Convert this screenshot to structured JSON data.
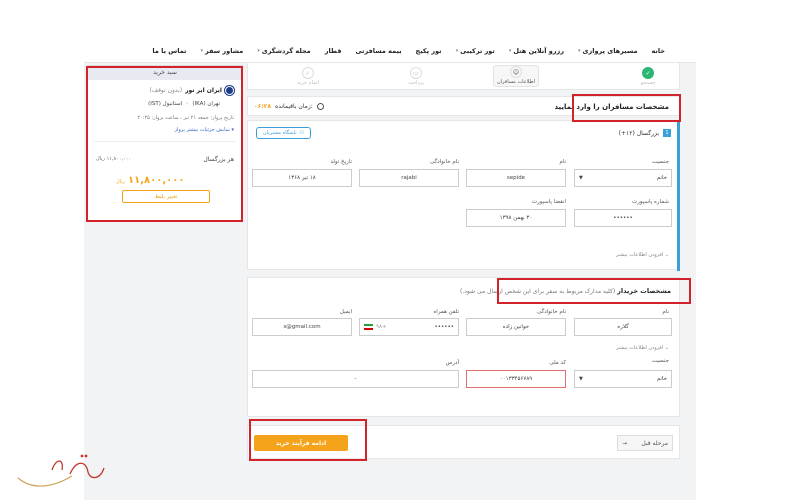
{
  "nav": {
    "items": [
      {
        "label": "خانه",
        "caret": false
      },
      {
        "label": "مسیرهای پروازی",
        "caret": true
      },
      {
        "label": "رزرو آنلاین هتل",
        "caret": true
      },
      {
        "label": "تور ترکیبی",
        "caret": true
      },
      {
        "label": "تور پکیج",
        "caret": false
      },
      {
        "label": "بیمه مسافرتی",
        "caret": false
      },
      {
        "label": "قطار",
        "caret": false
      },
      {
        "label": "مجله گردشگری",
        "caret": true
      },
      {
        "label": "مشاور سفر",
        "caret": true
      },
      {
        "label": "تماس با ما",
        "caret": false
      }
    ]
  },
  "stepper": {
    "steps": [
      "جستجو",
      "اطلاعات مسافران",
      "پرداخت",
      "اتمام خرید"
    ]
  },
  "timer": {
    "label": "زمان باقیمانده:",
    "value": "۰۶:۲۸"
  },
  "passengers": {
    "section_title": "مشخصات مسافران را وارد نمایید",
    "pax_number": "1",
    "pax_type": "بزرگسال (۱۲+)",
    "club_button": "باشگاه مشتریان",
    "fields": {
      "gender_label": "جنسیت",
      "gender_value": "خانم",
      "first_name_label": "نام",
      "first_name_value": "sepide",
      "last_name_label": "نام خانوادگی",
      "last_name_value": "rajabi",
      "birth_label": "تاریخ تولد",
      "birth_value": "۱۸ تیر ۱۳۶۸",
      "passport_no_label": "شماره پاسپورت",
      "passport_no_value": "••••••",
      "passport_exp_label": "انقضا پاسپورت",
      "passport_exp_value": "۳۰ بهمن ۱۳۹۸"
    },
    "more_info": "افزودن اطلاعات بیشتر"
  },
  "buyer": {
    "title": "مشخصات خریدار",
    "subtitle": "(کلیه مدارک مربوط به سفر برای این شخص ارسال می شود.)",
    "fields": {
      "name_label": "نام",
      "name_value": "گلاره",
      "last_name_label": "نام خانوادگی",
      "last_name_value": "خوانین زاده",
      "phone_label": "تلفن همراه",
      "phone_prefix": "+۹۸",
      "phone_value": "••••••",
      "email_label": "ایمیل",
      "email_value": "s@gmail.com",
      "gender_label": "جنسیت",
      "gender_value": "خانم",
      "national_code_label": "کد ملی",
      "national_code_value": "۰۰۱۳۳۴۵۶۷۸۹",
      "address_label": "آدرس",
      "address_value": "-"
    },
    "more_info": "افزودن اطلاعات بیشتر"
  },
  "actions": {
    "continue": "ادامه فرآیند خرید",
    "previous": "مرحله قبل"
  },
  "summary": {
    "header": "سبد خرید",
    "airline": "ایران ایر تور",
    "airline_note": "(بدون توقف)",
    "origin": "تهران (IKA)",
    "destination": "استانبول (IST)",
    "flight_date": "تاریخ پرواز: جمعه ۲۱ تیر ، ساعت پرواز: ۲۰:۴۵",
    "details_link": "نمایش جزئیات بیشتر پرواز",
    "per_adult_label": "هر بزرگسال",
    "per_adult_price": "۱۱,۸۰۰,۰۰۰ ریال",
    "total_price": "۱۱,۸۰۰,۰۰۰",
    "currency": "ریال",
    "change_button": "تغییر بلیط"
  },
  "colors": {
    "accent": "#f5a31a",
    "highlight": "#d2232a",
    "info_blue": "#3aa0d8"
  },
  "watermark_text": "الی گشت"
}
